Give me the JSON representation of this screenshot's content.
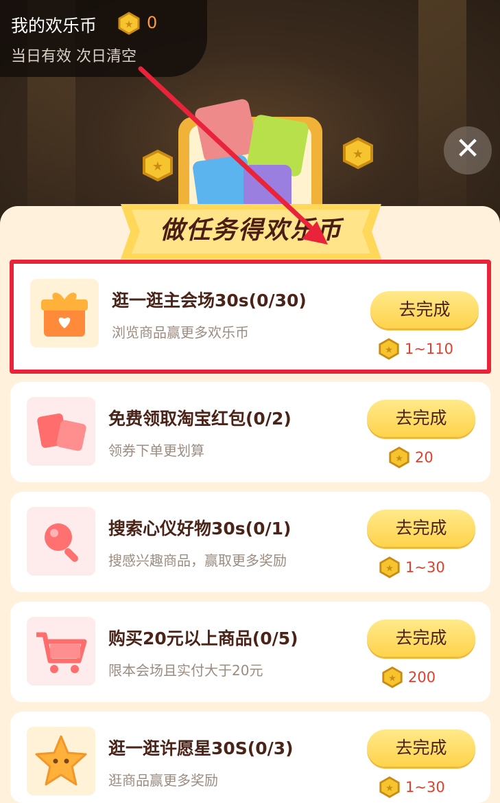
{
  "coin_header": {
    "title": "我的欢乐币",
    "count": "0",
    "subtitle": "当日有效 次日清空"
  },
  "banner_title": "做任务得欢乐币",
  "close_icon": "close-icon",
  "colors": {
    "highlight_border": "#e8233a",
    "button_yellow": "#ffd34c",
    "reward_text": "#e2402c",
    "panel_bg": "#fff1dc"
  },
  "tasks": [
    {
      "name": "逛一逛主会场30s(0/30)",
      "desc": "浏览商品赢更多欢乐币",
      "button": "去完成",
      "reward": "1~110",
      "icon": "gift-heart-icon"
    },
    {
      "name": "免费领取淘宝红包(0/2)",
      "desc": "领券下单更划算",
      "button": "去完成",
      "reward": "20",
      "icon": "red-packet-icon"
    },
    {
      "name": "搜索心仪好物30s(0/1)",
      "desc": "搜感兴趣商品，赢取更多奖励",
      "button": "去完成",
      "reward": "1~30",
      "icon": "search-magnifier-icon"
    },
    {
      "name": "购买20元以上商品(0/5)",
      "desc": "限本会场且实付大于20元",
      "button": "去完成",
      "reward": "200",
      "icon": "shopping-cart-icon"
    },
    {
      "name": "逛一逛许愿星30S(0/3)",
      "desc": "逛商品赢更多奖励",
      "button": "去完成",
      "reward": "1~30",
      "icon": "star-icon"
    }
  ]
}
